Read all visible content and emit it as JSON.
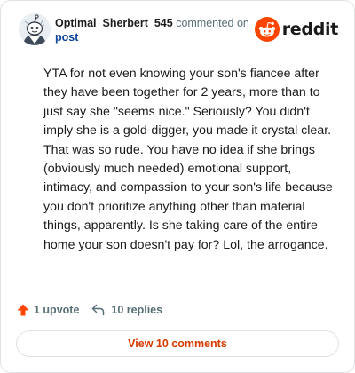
{
  "comment": {
    "author": "Optimal_Sherbert_545",
    "action_text": "commented on",
    "post_link": "post",
    "body": "YTA for not even knowing your son's fiancee after they have been together for 2 years, more than to just say she \"seems nice.\" Seriously? You didn't imply she is a gold-digger, you made it crystal clear. That was so rude. You have no idea if she brings (obviously much needed) emotional support, intimacy, and compassion to your son's life because you don't prioritize anything other than material things, apparently. Is she taking care of the entire home your son doesn't pay for? Lol, the arrogance."
  },
  "brand": {
    "wordmark": "reddit",
    "icon": "reddit-snoo-icon",
    "color": "#ff4500"
  },
  "actions": {
    "upvote_label": "1 upvote",
    "upvote_icon": "upvote-arrow-icon",
    "upvote_color": "#ff4500",
    "reply_label": "10 replies",
    "reply_icon": "reply-arrow-icon"
  },
  "footer": {
    "view_comments_label": "View 10 comments",
    "accent_color": "#d93a00"
  }
}
